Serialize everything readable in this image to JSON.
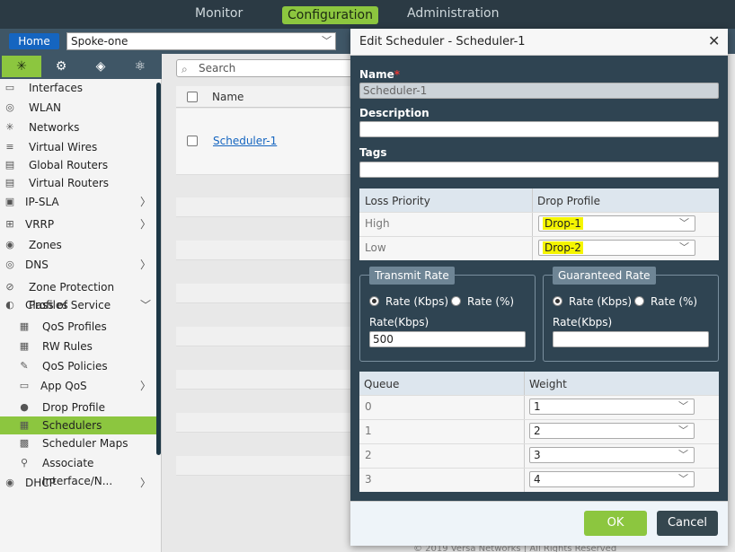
{
  "topnav": {
    "monitor": "Monitor",
    "configuration": "Configuration",
    "administration": "Administration"
  },
  "header": {
    "home": "Home",
    "org": "Spoke-one"
  },
  "sidebar": {
    "tab_icons": [
      "network-icon",
      "gear-icon",
      "cube-icon",
      "settings-globe-icon"
    ],
    "items": [
      {
        "label": "Interfaces"
      },
      {
        "label": "WLAN"
      },
      {
        "label": "Networks"
      },
      {
        "label": "Virtual Wires"
      },
      {
        "label": "Global Routers"
      },
      {
        "label": "Virtual Routers"
      },
      {
        "label": "IP-SLA"
      },
      {
        "label": "VRRP"
      },
      {
        "label": "Zones"
      },
      {
        "label": "DNS"
      },
      {
        "label": "Zone Protection Profiles"
      },
      {
        "label": "Class of Service"
      },
      {
        "label": "QoS Profiles"
      },
      {
        "label": "RW Rules"
      },
      {
        "label": "QoS Policies"
      },
      {
        "label": "App QoS"
      },
      {
        "label": "Drop Profile"
      },
      {
        "label": "Schedulers"
      },
      {
        "label": "Scheduler Maps"
      },
      {
        "label": "Associate Interface/N..."
      },
      {
        "label": "DHCP"
      }
    ]
  },
  "main": {
    "search_placeholder": "Search",
    "column_name": "Name",
    "row_link": "Scheduler-1",
    "footer": "© 2019 Versa Networks | All Rights Reserved"
  },
  "dialog": {
    "title": "Edit Scheduler - Scheduler-1",
    "name_label": "Name",
    "name_value": "Scheduler-1",
    "description_label": "Description",
    "tags_label": "Tags",
    "loss_table": {
      "col1": "Loss Priority",
      "col2": "Drop Profile",
      "rows": [
        {
          "priority": "High",
          "profile": "Drop-1"
        },
        {
          "priority": "Low",
          "profile": "Drop-2"
        }
      ]
    },
    "transmit": {
      "title": "Transmit Rate",
      "opt1": "Rate (Kbps)",
      "opt2": "Rate (%)",
      "field_label": "Rate(Kbps)",
      "value": "500"
    },
    "guaranteed": {
      "title": "Guaranteed Rate",
      "opt1": "Rate (Kbps)",
      "opt2": "Rate (%)",
      "field_label": "Rate(Kbps)",
      "value": ""
    },
    "queue_table": {
      "col1": "Queue",
      "col2": "Weight",
      "rows": [
        {
          "queue": "0",
          "weight": "1"
        },
        {
          "queue": "1",
          "weight": "2"
        },
        {
          "queue": "2",
          "weight": "3"
        },
        {
          "queue": "3",
          "weight": "4"
        }
      ]
    },
    "ok": "OK",
    "cancel": "Cancel"
  }
}
